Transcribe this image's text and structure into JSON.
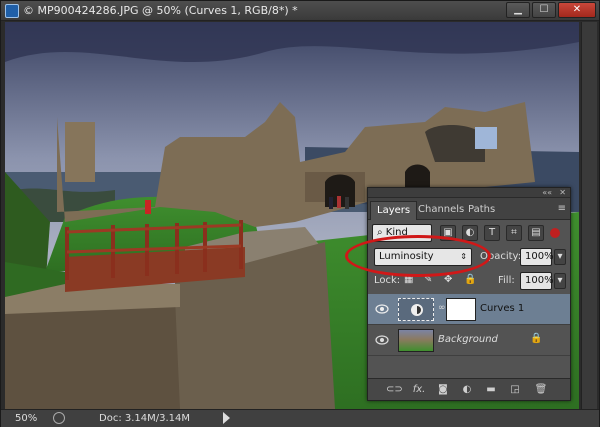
{
  "window": {
    "title": "© MP900424286.JPG @ 50% (Curves 1, RGB/8*) *",
    "buttons": {
      "minimize": "▁",
      "maximize": "☐",
      "close": "✕"
    }
  },
  "status": {
    "zoom": "50%",
    "doc": "Doc: 3.14M/3.14M"
  },
  "layers_panel": {
    "tabs": [
      {
        "label": "Layers",
        "active": true
      },
      {
        "label": "Channels",
        "active": false
      },
      {
        "label": "Paths",
        "active": false
      }
    ],
    "filter_kind": "Kind",
    "blend_mode": "Luminosity",
    "opacity_label": "Opacity:",
    "opacity_value": "100%",
    "lock_label": "Lock:",
    "fill_label": "Fill:",
    "fill_value": "100%",
    "layers": [
      {
        "name": "Curves 1",
        "selected": true
      },
      {
        "name": "Background",
        "selected": false,
        "locked": true
      }
    ],
    "footer_icons": [
      "link-icon",
      "fx-icon",
      "mask-icon",
      "adjustment-icon",
      "group-icon",
      "new-layer-icon",
      "trash-icon"
    ]
  },
  "colors": {
    "highlight": "#d01818",
    "panel_bg": "#535353",
    "selected_row": "#6d7f93"
  }
}
